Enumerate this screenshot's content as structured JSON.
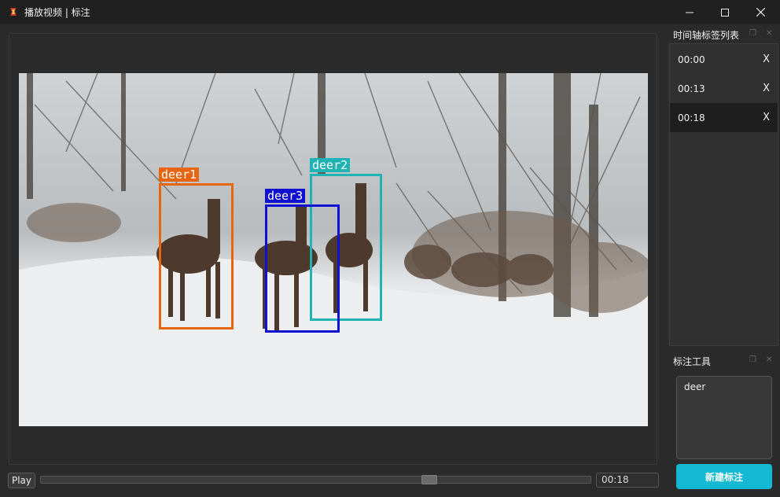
{
  "window": {
    "title": "播放视频 | 标注",
    "icon": "app-logo-icon"
  },
  "video": {
    "annotations": [
      {
        "label": "deer1",
        "color": "#e8650f"
      },
      {
        "label": "deer2",
        "color": "#1fb3b3"
      },
      {
        "label": "deer3",
        "color": "#1010d0"
      }
    ]
  },
  "controls": {
    "play_label": "Play",
    "current_time": "00:18",
    "progress": 0.71
  },
  "timeline_dock": {
    "title": "时间轴标签列表",
    "items": [
      {
        "time": "00:00",
        "remove": "X"
      },
      {
        "time": "00:13",
        "remove": "X"
      },
      {
        "time": "00:18",
        "remove": "X"
      }
    ],
    "selected_index": 2
  },
  "tool_dock": {
    "title": "标注工具",
    "label_text": "deer",
    "new_button": "新建标注"
  },
  "colors": {
    "accent": "#14b8d2",
    "background": "#2b2b2b",
    "titlebar": "#202020"
  }
}
